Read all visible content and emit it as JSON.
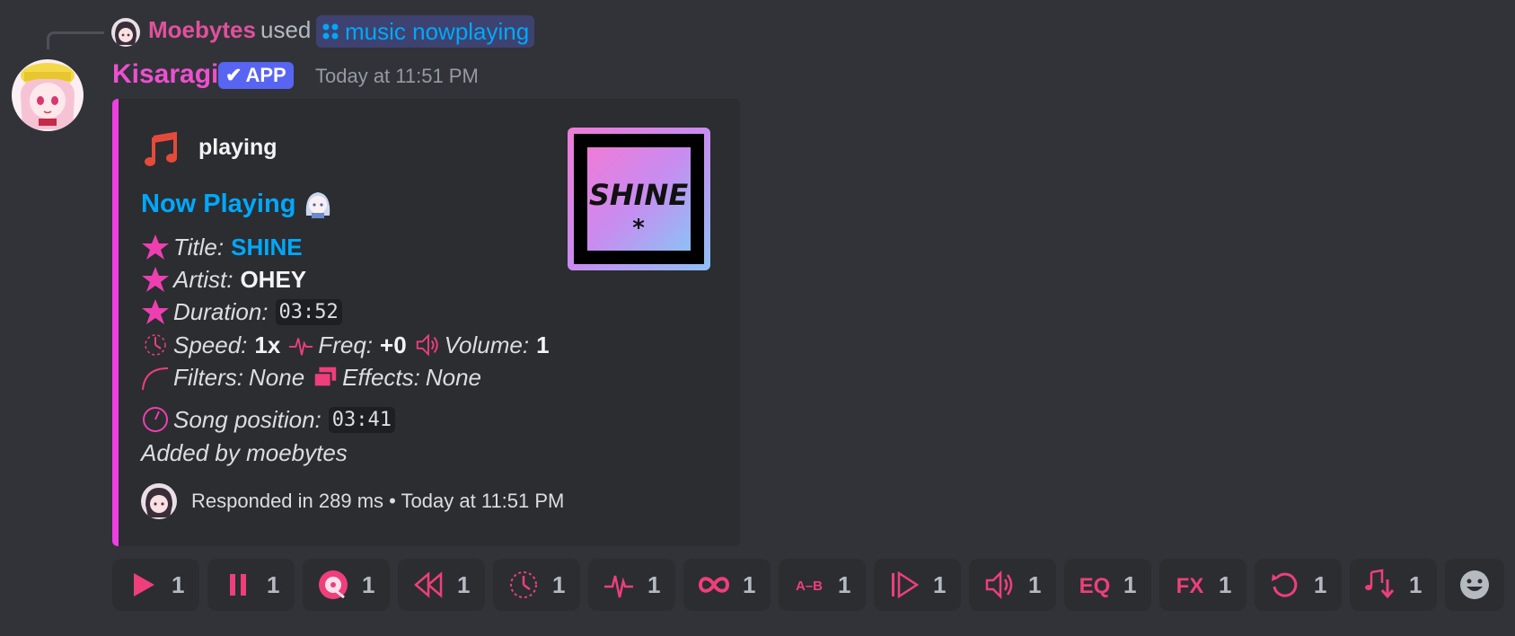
{
  "reply": {
    "user": "Moebytes",
    "used_text": "used",
    "command": "music nowplaying"
  },
  "message": {
    "bot_name": "Kisaragi",
    "app_badge": "APP",
    "timestamp": "Today at 11:51 PM"
  },
  "embed": {
    "accent_color": "#ee3fe0",
    "author_icon": "music-note-icon",
    "author": "playing",
    "title": "Now Playing",
    "fields": {
      "title_label": "Title:",
      "title_value": "SHINE",
      "artist_label": "Artist:",
      "artist_value": "OHEY",
      "duration_label": "Duration:",
      "duration_value": "03:52",
      "speed_label": "Speed:",
      "speed_value": "1x",
      "freq_label": "Freq:",
      "freq_value": "+0",
      "volume_label": "Volume:",
      "volume_value": "1",
      "filters_label": "Filters:",
      "filters_value": "None",
      "effects_label": "Effects:",
      "effects_value": "None",
      "position_label": "Song position:",
      "position_value": "03:41",
      "added_by": "Added by moebytes"
    },
    "thumbnail_text": "SHINE",
    "footer": "Responded in 289 ms • Today at 11:51 PM"
  },
  "reactions": [
    {
      "icon": "play-icon",
      "count": "1"
    },
    {
      "icon": "pause-icon",
      "count": "1"
    },
    {
      "icon": "disc-icon",
      "count": "1"
    },
    {
      "icon": "rewind-icon",
      "count": "1"
    },
    {
      "icon": "speed-icon",
      "count": "1"
    },
    {
      "icon": "pitch-icon",
      "count": "1"
    },
    {
      "icon": "loop-icon",
      "count": "1"
    },
    {
      "icon": "ab-loop-icon",
      "count": "1"
    },
    {
      "icon": "skip-icon",
      "count": "1"
    },
    {
      "icon": "volume-icon",
      "count": "1"
    },
    {
      "icon": "eq-icon",
      "count": "1"
    },
    {
      "icon": "fx-icon",
      "count": "1"
    },
    {
      "icon": "reset-icon",
      "count": "1"
    },
    {
      "icon": "download-icon",
      "count": "1"
    }
  ],
  "reaction_labels": {
    "ab": "A–B",
    "eq": "EQ",
    "fx": "FX"
  }
}
